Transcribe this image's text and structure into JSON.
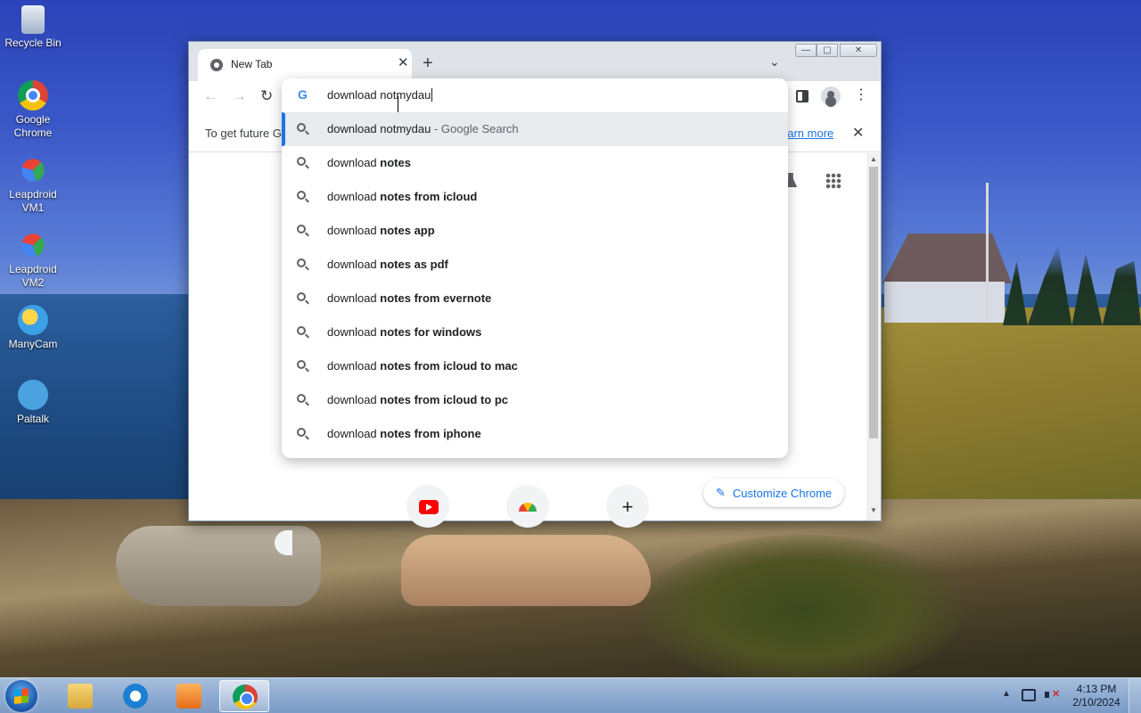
{
  "desktop": {
    "icons": [
      {
        "label": "Recycle Bin",
        "icon": "recycle-bin-icon"
      },
      {
        "label": "Google\nChrome",
        "icon": "chrome-icon"
      },
      {
        "label": "Leapdroid\nVM1",
        "icon": "leapdroid-icon"
      },
      {
        "label": "Leapdroid\nVM2",
        "icon": "leapdroid-icon"
      },
      {
        "label": "ManyCam",
        "icon": "manycam-icon"
      },
      {
        "label": "Paltalk",
        "icon": "paltalk-icon"
      }
    ]
  },
  "browser": {
    "tab": {
      "title": "New Tab",
      "close": "✕"
    },
    "new_tab": "+",
    "tab_search": "⌄",
    "window_controls": {
      "minimize": "—",
      "maximize": "▢",
      "close": "✕"
    },
    "nav": {
      "back": "←",
      "forward": "→",
      "reload": "↻",
      "menu": "⋮"
    },
    "infobar": {
      "text": "To get future G",
      "link": "earn more",
      "close": "✕"
    },
    "omnibox": {
      "input_value": "download notmydau",
      "suggestions": [
        {
          "prefix": "download notmydau",
          "bold": "",
          "suffix": " - Google Search",
          "selected": true
        },
        {
          "prefix": "download ",
          "bold": "notes",
          "suffix": "",
          "selected": false
        },
        {
          "prefix": "download ",
          "bold": "notes from icloud",
          "suffix": "",
          "selected": false
        },
        {
          "prefix": "download ",
          "bold": "notes app",
          "suffix": "",
          "selected": false
        },
        {
          "prefix": "download ",
          "bold": "notes as pdf",
          "suffix": "",
          "selected": false
        },
        {
          "prefix": "download ",
          "bold": "notes from evernote",
          "suffix": "",
          "selected": false
        },
        {
          "prefix": "download ",
          "bold": "notes for windows",
          "suffix": "",
          "selected": false
        },
        {
          "prefix": "download ",
          "bold": "notes from icloud to mac",
          "suffix": "",
          "selected": false
        },
        {
          "prefix": "download ",
          "bold": "notes from icloud to pc",
          "suffix": "",
          "selected": false
        },
        {
          "prefix": "download ",
          "bold": "notes from iphone",
          "suffix": "",
          "selected": false
        }
      ]
    },
    "newtab_page": {
      "customize_label": "Customize Chrome",
      "add_shortcut": "+"
    }
  },
  "taskbar": {
    "items": [
      "explorer-icon",
      "internet-explorer-icon",
      "media-player-icon",
      "chrome-icon"
    ],
    "active_item": "chrome-icon",
    "tray_arrow": "▲",
    "clock": {
      "time": "4:13 PM",
      "date": "2/10/2024"
    }
  },
  "colors": {
    "accent": "#1a73e8",
    "selected_row": "#e8eaed",
    "taskbar": "#8eabd1"
  }
}
